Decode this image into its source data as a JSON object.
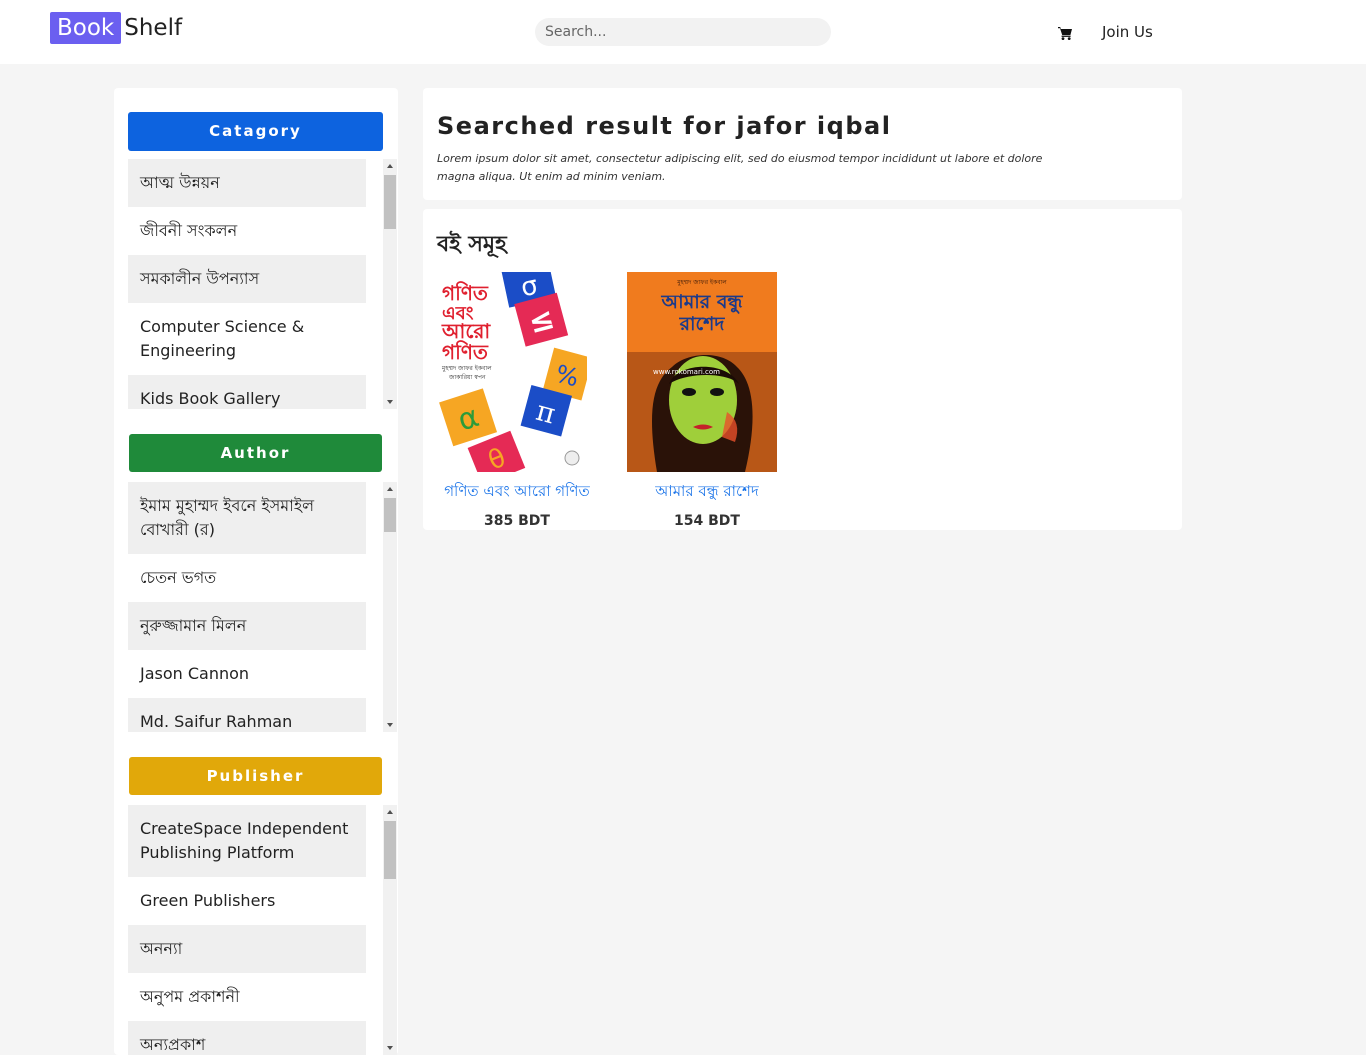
{
  "header": {
    "logo_part1": "Book",
    "logo_part2": "Shelf",
    "search_placeholder": "Search...",
    "cart_icon": "shopping-cart-icon",
    "join_label": "Join Us",
    "logo_color": "#6b5ff0"
  },
  "sidebar": {
    "category": {
      "label": "Catagory",
      "color": "#0d63df",
      "items": [
        "আত্ম উন্নয়ন",
        "জীবনী সংকলন",
        "সমকালীন উপন্যাস",
        "Computer Science & Engineering",
        "Kids Book Gallery"
      ]
    },
    "author": {
      "label": "Author",
      "color": "#1f8a3a",
      "items": [
        "ইমাম মুহাম্মদ ইবনে ইসমাইল বোখারী (র)",
        "চেতন ভগত",
        "নুরুজ্জামান মিলন",
        "Jason Cannon",
        "Md. Saifur Rahman"
      ]
    },
    "publisher": {
      "label": "Publisher",
      "color": "#e1a80a",
      "items": [
        "CreateSpace Independent Publishing Platform",
        "Green Publishers",
        "অনন্যা",
        "অনুপম প্রকাশনী",
        "অন্যপ্রকাশ"
      ]
    }
  },
  "result": {
    "title": "Searched result for jafor iqbal",
    "description": "Lorem ipsum dolor sit amet, consectetur adipiscing elit, sed do eiusmod tempor incididunt ut labore et dolore magna aliqua. Ut enim ad minim veniam."
  },
  "books": {
    "heading": "বই সমূহ",
    "items": [
      {
        "title": "গণিত এবং আরো গণিত",
        "price": "385 BDT",
        "cover_lines": [
          "গণিত",
          "এবং",
          "আরো",
          "গণিত"
        ],
        "cover_author": "মুহম্মদ জাফর ইকবাল",
        "cover_coauthor": "জাকারিয়া স্বপন",
        "cover_symbols": [
          "σ",
          "%",
          "π",
          "α",
          "θ",
          "≤"
        ]
      },
      {
        "title": "আমার বন্ধু রাশেদ",
        "price": "154 BDT",
        "cover_lines": [
          "আমার বন্ধু",
          "রাশেদ"
        ],
        "cover_author": "মুহম্মদ জাফর ইকবাল",
        "cover_watermark": "www.rokomari.com"
      }
    ]
  }
}
